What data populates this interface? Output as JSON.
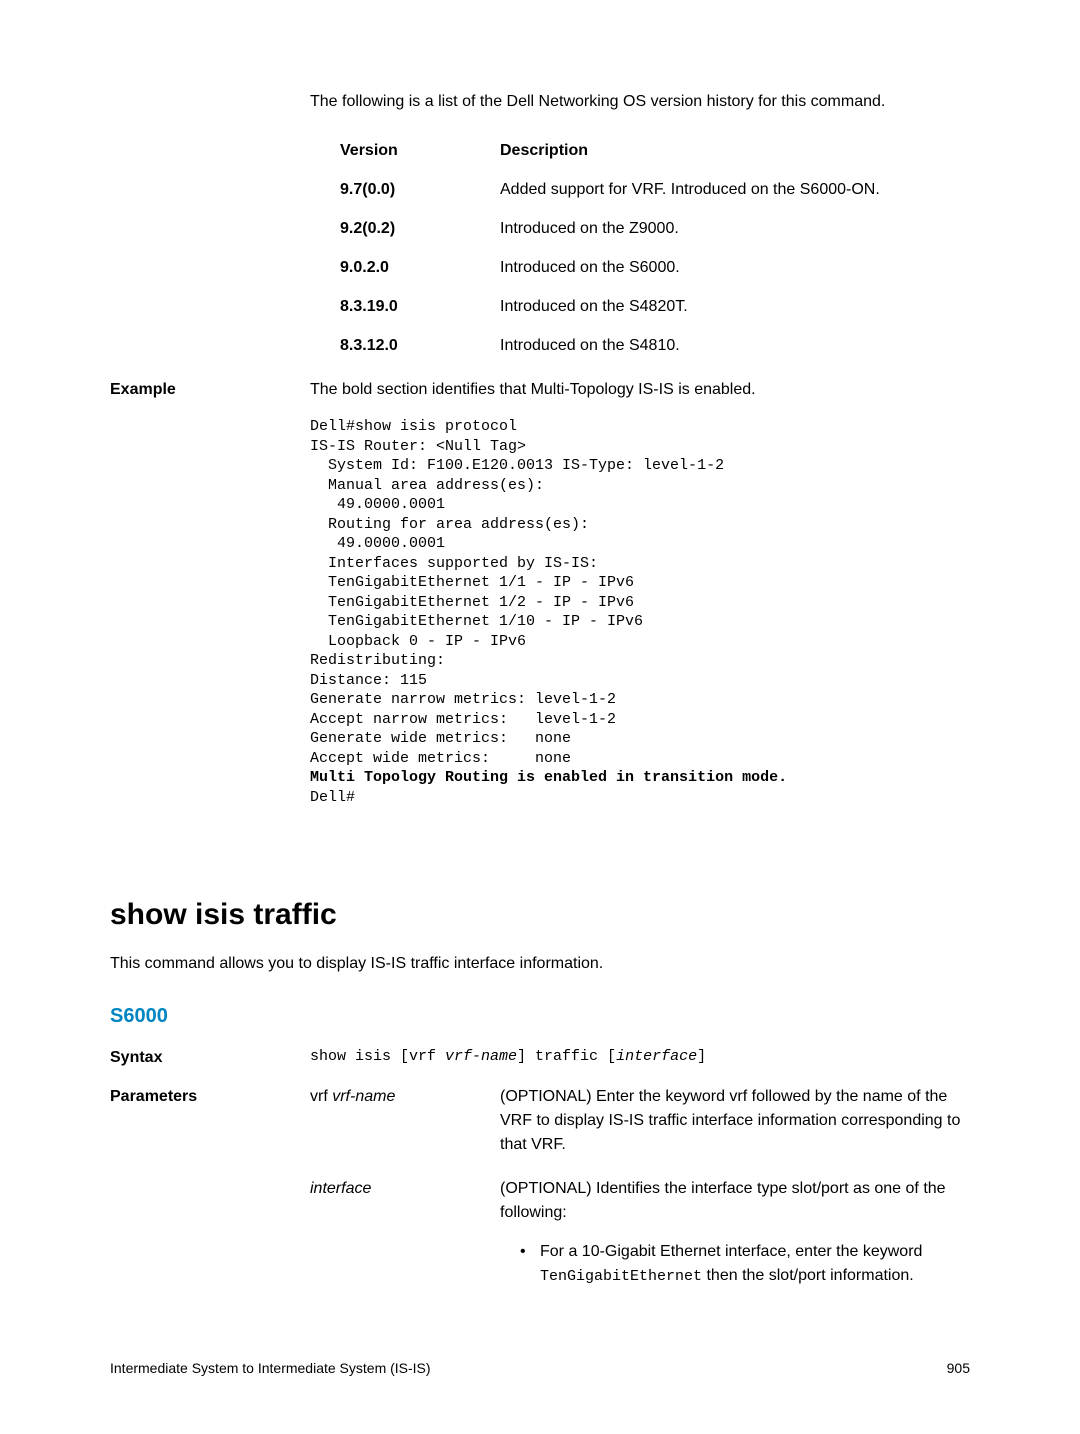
{
  "intro": "The following is a list of the Dell Networking OS version history for this command.",
  "versionHeader": {
    "col1": "Version",
    "col2": "Description"
  },
  "versions": [
    {
      "ver": "9.7(0.0)",
      "desc": "Added support for VRF. Introduced on the S6000-ON."
    },
    {
      "ver": "9.2(0.2)",
      "desc": "Introduced on the Z9000."
    },
    {
      "ver": "9.0.2.0",
      "desc": "Introduced on the S6000."
    },
    {
      "ver": "8.3.19.0",
      "desc": "Introduced on the S4820T."
    },
    {
      "ver": "8.3.12.0",
      "desc": "Introduced on the S4810."
    }
  ],
  "exampleLabel": "Example",
  "exampleIntro": "The bold section identifies that Multi-Topology IS-IS is enabled.",
  "codeLines": [
    "Dell#show isis protocol",
    "IS-IS Router: <Null Tag>",
    "  System Id: F100.E120.0013 IS-Type: level-1-2",
    "  Manual area address(es):",
    "   49.0000.0001",
    "  Routing for area address(es):",
    "   49.0000.0001",
    "  Interfaces supported by IS-IS:",
    "  TenGigabitEthernet 1/1 - IP - IPv6",
    "  TenGigabitEthernet 1/2 - IP - IPv6",
    "  TenGigabitEthernet 1/10 - IP - IPv6",
    "  Loopback 0 - IP - IPv6",
    "Redistributing:",
    "Distance: 115",
    "Generate narrow metrics: level-1-2",
    "Accept narrow metrics:   level-1-2",
    "Generate wide metrics:   none",
    "Accept wide metrics:     none"
  ],
  "codeBold": "Multi Topology Routing is enabled in transition mode.",
  "codeEnd": "Dell#",
  "sectionTitle": "show isis traffic",
  "sectionDesc": "This command allows you to display IS-IS traffic interface information.",
  "subsection": "S6000",
  "syntaxLabel": "Syntax",
  "syntaxCmd": "show isis [vrf ",
  "syntaxVrfName": "vrf-name",
  "syntaxMid": "] traffic [",
  "syntaxInterface": "interface",
  "syntaxEnd": "]",
  "parametersLabel": "Parameters",
  "params": [
    {
      "name1": "vrf ",
      "name2": "vrf-name",
      "desc": "(OPTIONAL) Enter the keyword vrf followed by the name of the VRF to display IS-IS traffic interface information corresponding to that VRF."
    },
    {
      "name2": "interface",
      "desc": "(OPTIONAL) Identifies the interface type slot/port as one of the following:"
    }
  ],
  "bulletPre": "For a 10-Gigabit Ethernet interface, enter the keyword ",
  "bulletCode": "TenGigabitEthernet",
  "bulletPost": " then the slot/port information.",
  "footerLeft": "Intermediate System to Intermediate System (IS-IS)",
  "footerRight": "905"
}
